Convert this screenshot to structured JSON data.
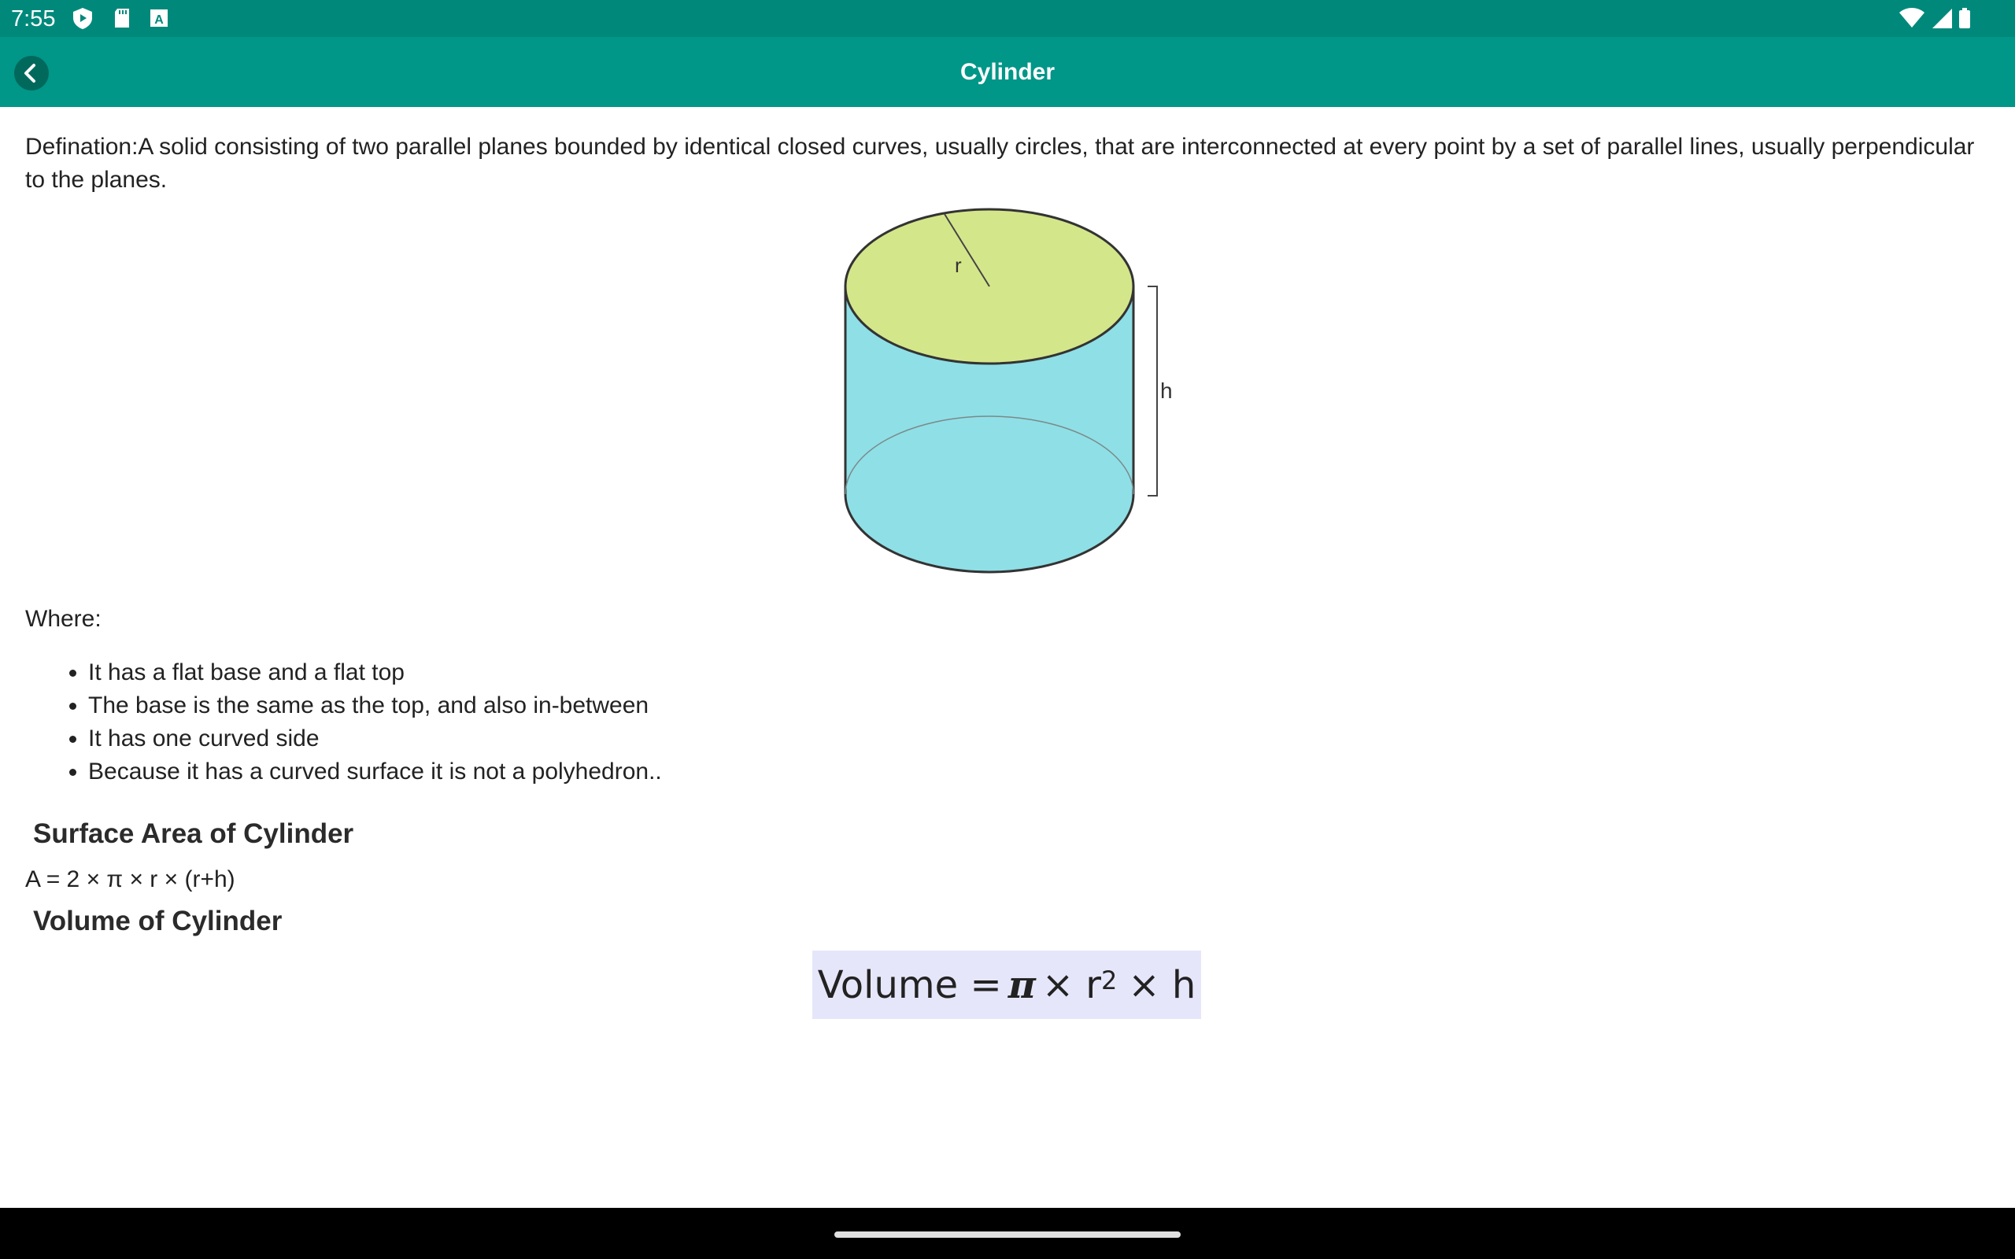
{
  "status_bar": {
    "time": "7:55",
    "left_icons": [
      "play-protect-icon",
      "sd-card-icon",
      "keyboard-a-icon"
    ],
    "right_icons": [
      "wifi-icon",
      "cell-signal-icon",
      "battery-icon"
    ]
  },
  "app_bar": {
    "title": "Cylinder",
    "back_icon": "chevron-left-icon",
    "color": "#009688",
    "status_color": "#00897b"
  },
  "definition": "Defination:A solid consisting of two parallel planes bounded by identical closed curves, usually circles, that are interconnected at every point by a set of parallel lines, usually perpendicular to the planes.",
  "figure": {
    "radius_label": "r",
    "height_label": "h",
    "top_color": "#d4e68a",
    "side_color": "#8fdfe6"
  },
  "where_label": "Where:",
  "properties": [
    "It has a flat base and a flat top",
    "The base is the same as the top, and also in-between",
    "It has one curved side",
    "Because it has a curved surface it is not a polyhedron.."
  ],
  "surface_area": {
    "heading": "Surface Area of Cylinder",
    "formula": "A = 2 × π × r × (r+h)"
  },
  "volume": {
    "heading": "Volume of Cylinder",
    "lhs": "Volume =",
    "pi": "π",
    "times1": "× r",
    "exponent": "2",
    "times2": "× h",
    "box_color": "#e6e6fa"
  }
}
